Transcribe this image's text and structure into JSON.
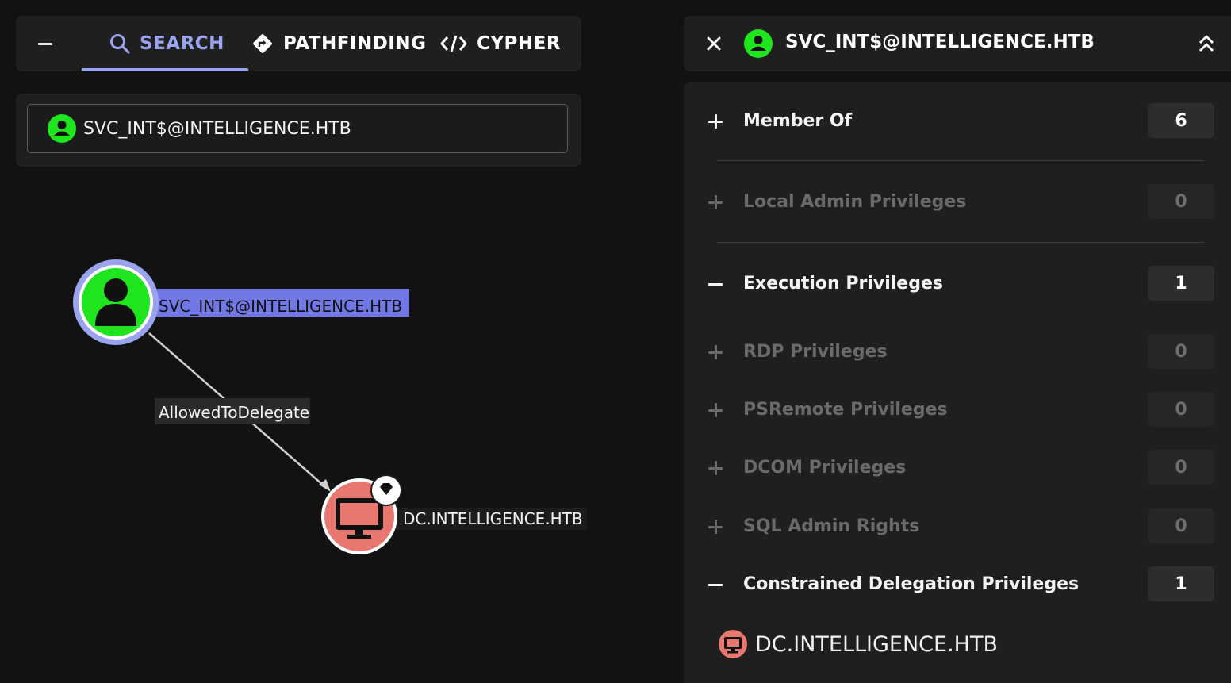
{
  "tabs": {
    "search": "SEARCH",
    "pathfinding": "PATHFINDING",
    "cypher": "CYPHER"
  },
  "search": {
    "value": "SVC_INT$@INTELLIGENCE.HTB"
  },
  "graph": {
    "source_node": "SVC_INT$@INTELLIGENCE.HTB",
    "edge_label": "AllowedToDelegate",
    "target_node": "DC.INTELLIGENCE.HTB"
  },
  "detail": {
    "title": "SVC_INT$@INTELLIGENCE.HTB",
    "sections": [
      {
        "label": "Member Of",
        "count": "6"
      },
      {
        "label": "Local Admin Privileges",
        "count": "0"
      },
      {
        "label": "Execution Privileges",
        "count": "1"
      },
      {
        "label": "RDP Privileges",
        "count": "0"
      },
      {
        "label": "PSRemote Privileges",
        "count": "0"
      },
      {
        "label": "DCOM Privileges",
        "count": "0"
      },
      {
        "label": "SQL Admin Rights",
        "count": "0"
      },
      {
        "label": "Constrained Delegation Privileges",
        "count": "1"
      }
    ],
    "result_item": "DC.INTELLIGENCE.HTB"
  },
  "colors": {
    "accent": "#9aa3ee",
    "user_node": "#1ee51e",
    "computer_node": "#e8786f",
    "background": "#121212",
    "panel": "#1f1f1f"
  },
  "icons": {
    "collapse": "minus-icon",
    "search": "search-icon",
    "pathfinding": "diamond-arrow-icon",
    "cypher": "code-icon",
    "close": "close-icon",
    "expand_up": "double-chevron-up-icon",
    "user": "user-icon",
    "computer": "monitor-icon",
    "high_value": "gem-icon"
  }
}
